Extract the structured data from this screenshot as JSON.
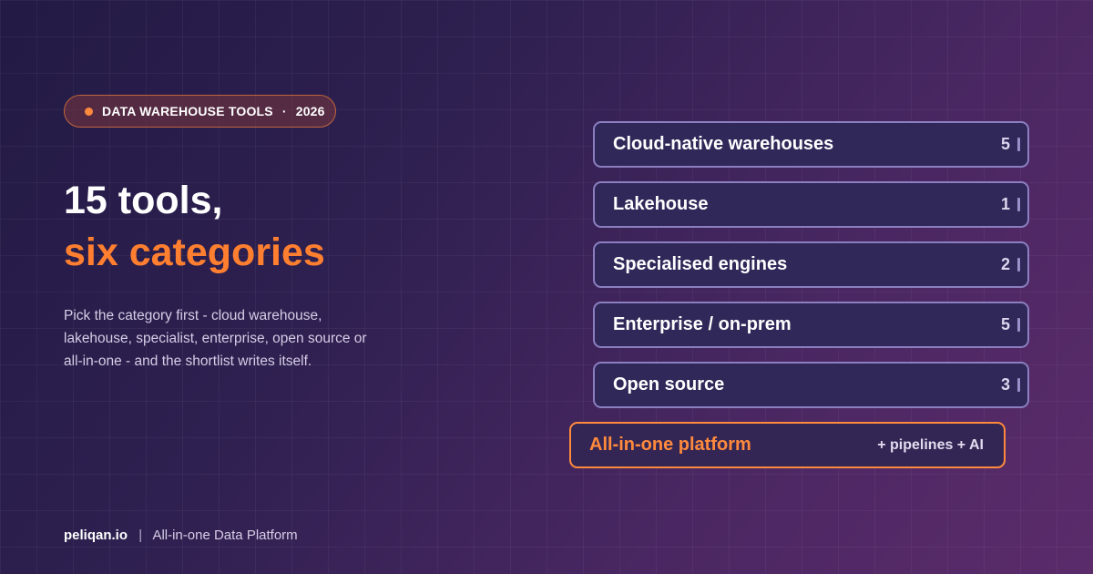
{
  "badge": {
    "label": "DATA WAREHOUSE TOOLS",
    "separator": "·",
    "year": "2026",
    "accent_color": "#ff8a3d"
  },
  "headline": {
    "line1": "15 tools,",
    "line2": "six categories",
    "accent_color": "#ff7f30"
  },
  "description": "Pick the category first - cloud warehouse, lakehouse, specialist, enterprise, open source or all-in-one - and the shortlist writes itself.",
  "categories": [
    {
      "label": "Cloud-native warehouses",
      "count": "5"
    },
    {
      "label": "Lakehouse",
      "count": "1"
    },
    {
      "label": "Specialised engines",
      "count": "2"
    },
    {
      "label": "Enterprise / on-prem",
      "count": "5"
    },
    {
      "label": "Open source",
      "count": "3"
    }
  ],
  "highlight": {
    "label": "All-in-one platform",
    "extra": "+ pipelines + AI",
    "border_color": "#ff8a3d"
  },
  "footer": {
    "brand": "peliqan.io",
    "separator": "|",
    "tagline": "All-in-one Data Platform"
  }
}
